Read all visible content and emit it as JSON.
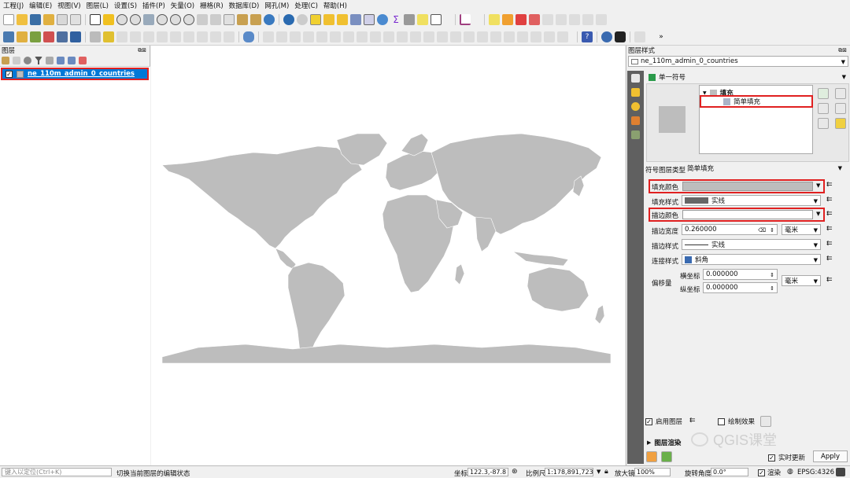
{
  "menu": [
    "工程(J)",
    "编辑(E)",
    "视图(V)",
    "图层(L)",
    "设置(S)",
    "插件(P)",
    "矢量(O)",
    "栅格(R)",
    "数据库(D)",
    "网孔(M)",
    "处理(C)",
    "帮助(H)"
  ],
  "layers_panel": {
    "title": "图层",
    "layer_name": "ne_110m_admin_0_countries"
  },
  "style_panel": {
    "title": "图层样式",
    "layer_combo": "ne_110m_admin_0_countries",
    "renderer": "单一符号",
    "tree": {
      "root": "填充",
      "child": "简单填充"
    },
    "symbol_layer_type_label": "符号图层类型",
    "symbol_layer_type_value": "简单填充",
    "fill_color_label": "填充颜色",
    "fill_style_label": "填充样式",
    "fill_style_value": "实线",
    "stroke_color_label": "描边颜色",
    "stroke_width_label": "描边宽度",
    "stroke_width_value": "0.260000",
    "stroke_width_unit": "毫米",
    "stroke_style_label": "描边样式",
    "stroke_style_value": "实线",
    "join_style_label": "连接样式",
    "join_style_value": "斜角",
    "offset_label": "偏移量",
    "offset_x_label": "横坐标",
    "offset_x_value": "0.000000",
    "offset_y_label": "纵坐标",
    "offset_y_value": "0.000000",
    "offset_unit": "毫米",
    "enable_layer_label": "启用图层",
    "draw_effects_label": "绘制效果",
    "layer_rendering_label": "图层渲染",
    "live_update_label": "实时更新",
    "apply_label": "Apply"
  },
  "watermark": "QGIS课堂",
  "status": {
    "locator_placeholder": "键入以定位(Ctrl+K)",
    "message": "切换当前图层的编辑状态",
    "coord_label": "坐标",
    "coord_value": "122.3,-87.8",
    "scale_label": "比例尺",
    "scale_value": "1:178,891,723",
    "magnifier_label": "放大镜",
    "magnifier_value": "100%",
    "rotation_label": "旋转角度",
    "rotation_value": "0.0°",
    "render_label": "渲染",
    "crs": "EPSG:4326"
  },
  "colors": {
    "fill": "#bdbdbd",
    "highlight": "#e02020",
    "selection": "#0078d7"
  }
}
